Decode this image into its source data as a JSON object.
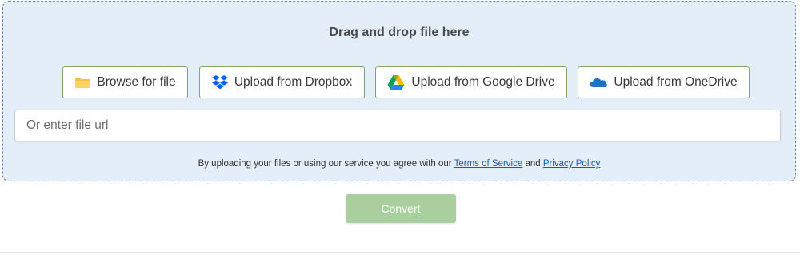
{
  "dropzone": {
    "title": "Drag and drop file here",
    "buttons": {
      "browse": {
        "label": "Browse for file",
        "icon": "folder-icon"
      },
      "dropbox": {
        "label": "Upload from Dropbox",
        "icon": "dropbox-icon"
      },
      "gdrive": {
        "label": "Upload from Google Drive",
        "icon": "google-drive-icon"
      },
      "onedrive": {
        "label": "Upload from OneDrive",
        "icon": "onedrive-icon"
      }
    },
    "url_input": {
      "placeholder": "Or enter file url",
      "value": ""
    },
    "terms": {
      "prefix": "By uploading your files or using our service you agree with our",
      "tos_link": "Terms of Service",
      "middle": "and",
      "privacy_link": "Privacy Policy"
    }
  },
  "convert": {
    "label": "Convert",
    "enabled": false
  },
  "colors": {
    "dropzone_bg": "#e3eef9",
    "dropzone_border": "#5b7fae",
    "button_border": "#7aa86f",
    "convert_bg_disabled": "#a9cf9f",
    "link": "#1d5aa6"
  }
}
